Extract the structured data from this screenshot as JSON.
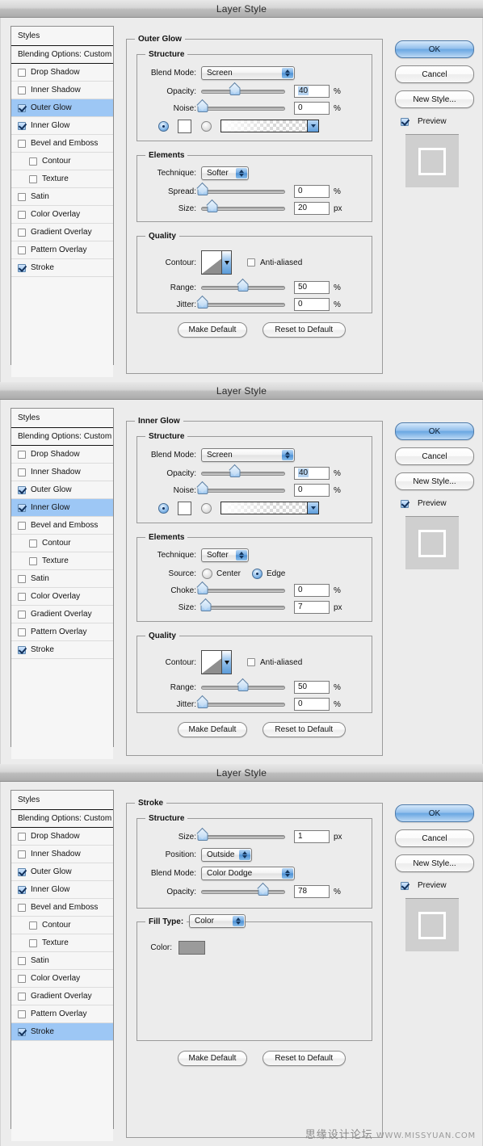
{
  "window": {
    "title": "Layer Style"
  },
  "sidebar": {
    "header": "Styles",
    "blending": "Blending Options: Custom",
    "items": [
      {
        "label": "Drop Shadow",
        "checked": false,
        "indent": false
      },
      {
        "label": "Inner Shadow",
        "checked": false,
        "indent": false
      },
      {
        "label": "Outer Glow",
        "checked": true,
        "indent": false
      },
      {
        "label": "Inner Glow",
        "checked": true,
        "indent": false
      },
      {
        "label": "Bevel and Emboss",
        "checked": false,
        "indent": false
      },
      {
        "label": "Contour",
        "checked": false,
        "indent": true
      },
      {
        "label": "Texture",
        "checked": false,
        "indent": true
      },
      {
        "label": "Satin",
        "checked": false,
        "indent": false
      },
      {
        "label": "Color Overlay",
        "checked": false,
        "indent": false
      },
      {
        "label": "Gradient Overlay",
        "checked": false,
        "indent": false
      },
      {
        "label": "Pattern Overlay",
        "checked": false,
        "indent": false
      },
      {
        "label": "Stroke",
        "checked": true,
        "indent": false
      }
    ]
  },
  "buttons": {
    "ok": "OK",
    "cancel": "Cancel",
    "new_style": "New Style...",
    "preview": "Preview",
    "make_default": "Make Default",
    "reset_to_default": "Reset to Default"
  },
  "dialogs": [
    {
      "effect_title": "Outer Glow",
      "selected_sidebar": "Outer Glow",
      "sections": {
        "structure": {
          "title": "Structure",
          "blend_mode_label": "Blend Mode:",
          "blend_mode_value": "Screen",
          "opacity_label": "Opacity:",
          "opacity_value": "40",
          "opacity_unit": "%",
          "opacity_pct": 40,
          "noise_label": "Noise:",
          "noise_value": "0",
          "noise_unit": "%",
          "noise_pct": 0,
          "fill_mode": "color",
          "color_swatch": "#ffffff"
        },
        "elements": {
          "title": "Elements",
          "technique_label": "Technique:",
          "technique_value": "Softer",
          "spread_label": "Spread:",
          "spread_value": "0",
          "spread_unit": "%",
          "spread_pct": 0,
          "size_label": "Size:",
          "size_value": "20",
          "size_unit": "px",
          "size_pct": 13
        },
        "quality": {
          "title": "Quality",
          "contour_label": "Contour:",
          "antialiased_label": "Anti-aliased",
          "antialiased_checked": false,
          "range_label": "Range:",
          "range_value": "50",
          "range_unit": "%",
          "range_pct": 50,
          "jitter_label": "Jitter:",
          "jitter_value": "0",
          "jitter_unit": "%",
          "jitter_pct": 0
        }
      }
    },
    {
      "effect_title": "Inner Glow",
      "selected_sidebar": "Inner Glow",
      "sections": {
        "structure": {
          "title": "Structure",
          "blend_mode_label": "Blend Mode:",
          "blend_mode_value": "Screen",
          "opacity_label": "Opacity:",
          "opacity_value": "40",
          "opacity_unit": "%",
          "opacity_pct": 40,
          "noise_label": "Noise:",
          "noise_value": "0",
          "noise_unit": "%",
          "noise_pct": 0,
          "fill_mode": "color",
          "color_swatch": "#ffffff"
        },
        "elements": {
          "title": "Elements",
          "technique_label": "Technique:",
          "technique_value": "Softer",
          "source_label": "Source:",
          "source_center": "Center",
          "source_edge": "Edge",
          "source_value": "Edge",
          "choke_label": "Choke:",
          "choke_value": "0",
          "choke_unit": "%",
          "choke_pct": 0,
          "size_label": "Size:",
          "size_value": "7",
          "size_unit": "px",
          "size_pct": 6
        },
        "quality": {
          "title": "Quality",
          "contour_label": "Contour:",
          "antialiased_label": "Anti-aliased",
          "antialiased_checked": false,
          "range_label": "Range:",
          "range_value": "50",
          "range_unit": "%",
          "range_pct": 50,
          "jitter_label": "Jitter:",
          "jitter_value": "0",
          "jitter_unit": "%",
          "jitter_pct": 0
        }
      }
    },
    {
      "effect_title": "Stroke",
      "selected_sidebar": "Stroke",
      "sections": {
        "structure": {
          "title": "Structure",
          "size_label": "Size:",
          "size_value": "1",
          "size_unit": "px",
          "size_pct": 0,
          "position_label": "Position:",
          "position_value": "Outside",
          "blend_mode_label": "Blend Mode:",
          "blend_mode_value": "Color Dodge",
          "opacity_label": "Opacity:",
          "opacity_value": "78",
          "opacity_unit": "%",
          "opacity_pct": 78
        },
        "fill": {
          "fill_type_label": "Fill Type:",
          "fill_type_value": "Color",
          "color_label": "Color:",
          "color_value": "#9b9b9b"
        }
      }
    }
  ],
  "watermark": {
    "cn": "思缘设计论坛",
    "en": "WWW.MISSYUAN.COM"
  }
}
